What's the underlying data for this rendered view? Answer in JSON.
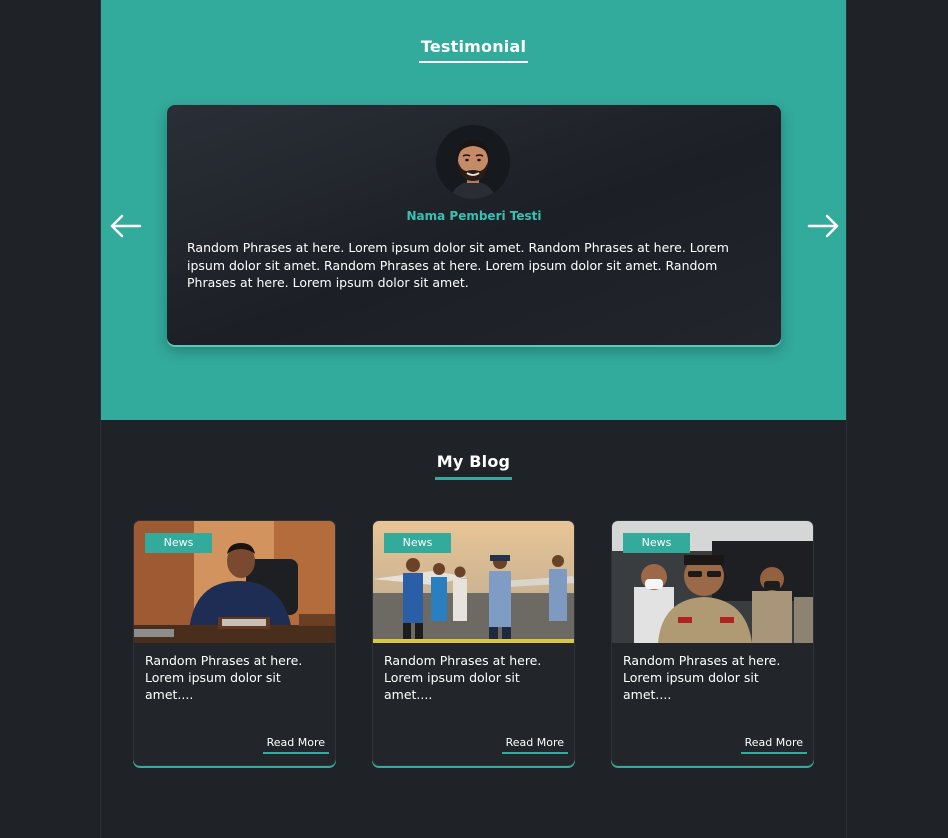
{
  "testimonial": {
    "title": "Testimonial",
    "name": "Nama Pemberi Testi",
    "text": "Random Phrases at here. Lorem ipsum dolor sit amet. Random Phrases at here. Lorem ipsum dolor sit amet. Random Phrases at here. Lorem ipsum dolor sit amet. Random Phrases at here. Lorem ipsum dolor sit amet.",
    "prev_icon": "arrow-left-icon",
    "next_icon": "arrow-right-icon"
  },
  "blog": {
    "title": "My Blog",
    "posts": [
      {
        "badge": "News",
        "excerpt": "Random Phrases at here. Lorem ipsum dolor sit amet....",
        "read_more": "Read More"
      },
      {
        "badge": "News",
        "excerpt": "Random Phrases at here. Lorem ipsum dolor sit amet....",
        "read_more": "Read More"
      },
      {
        "badge": "News",
        "excerpt": "Random Phrases at here. Lorem ipsum dolor sit amet....",
        "read_more": "Read More"
      }
    ]
  },
  "colors": {
    "accent": "#32aa9c",
    "name_text": "#35c2b2",
    "background": "#1f2226"
  }
}
